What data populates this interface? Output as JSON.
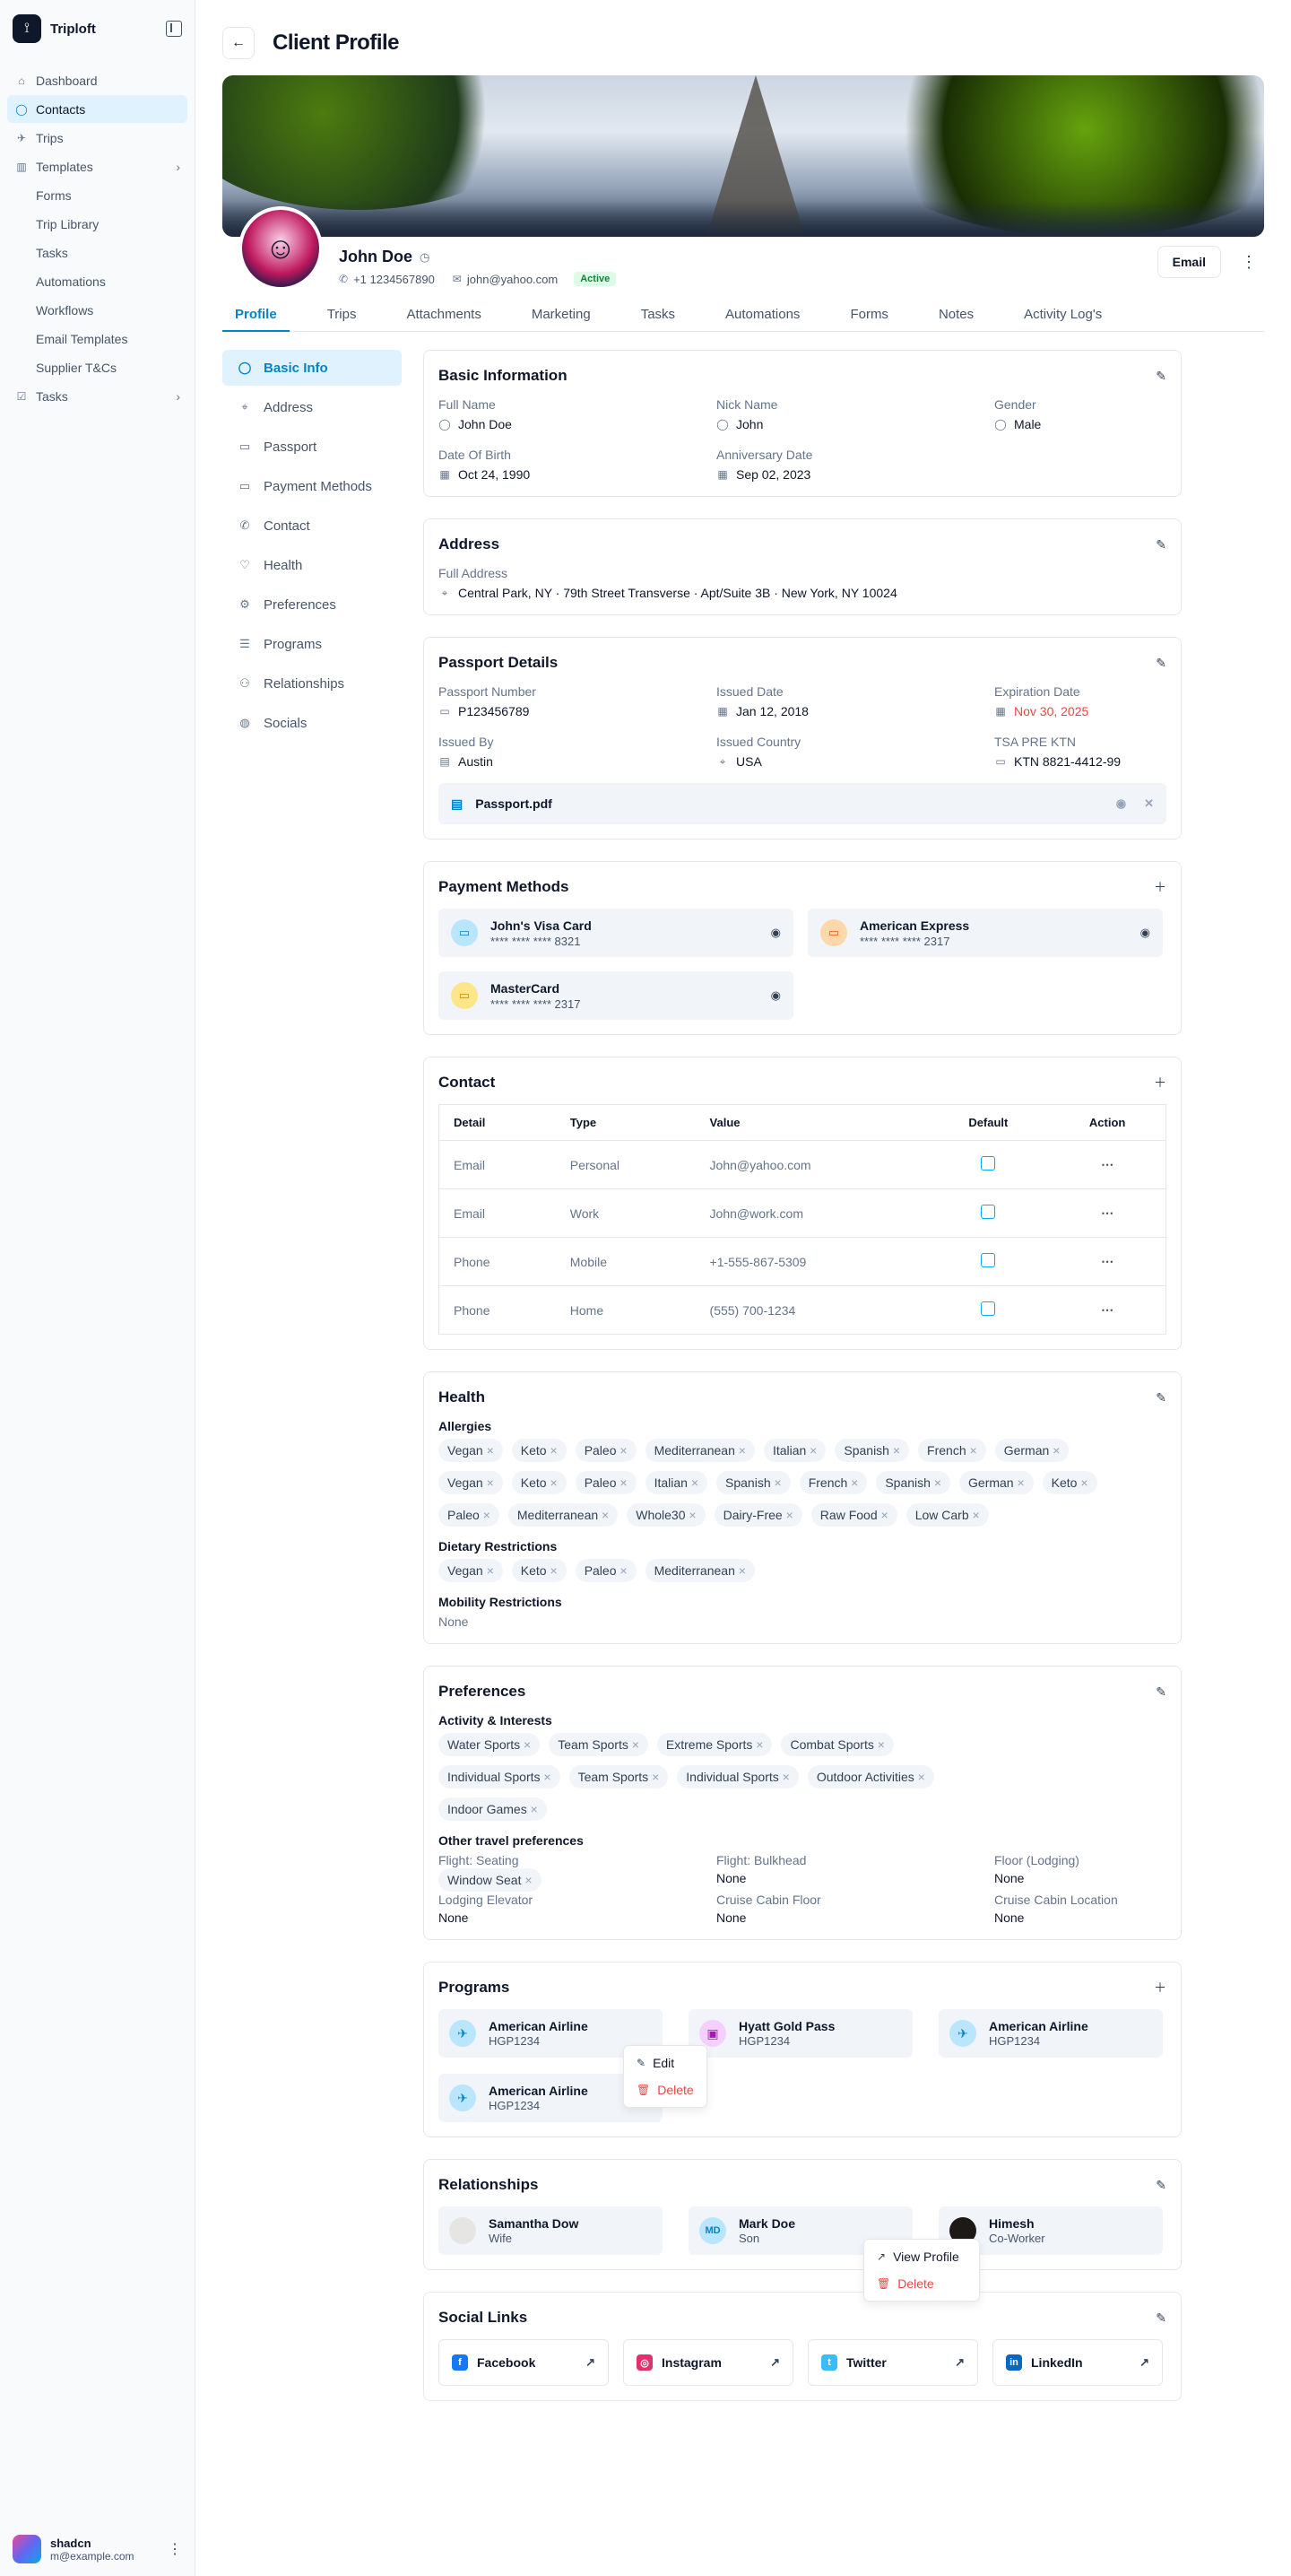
{
  "app": {
    "brand": "Triploft"
  },
  "sidebar": {
    "items": [
      {
        "label": "Dashboard",
        "icon": "home-icon",
        "glyph": "⌂"
      },
      {
        "label": "Contacts",
        "icon": "user-icon",
        "glyph": "◯",
        "active": true
      },
      {
        "label": "Trips",
        "icon": "plane-icon",
        "glyph": "✈"
      },
      {
        "label": "Templates",
        "icon": "chart-icon",
        "glyph": "▥",
        "chev": true
      }
    ],
    "sub_items": [
      "Forms",
      "Trip Library",
      "Tasks",
      "Automations",
      "Workflows",
      "Email Templates",
      "Supplier T&Cs"
    ],
    "tasks": {
      "label": "Tasks",
      "icon": "checkbox-icon",
      "glyph": "☑"
    }
  },
  "user": {
    "name": "shadcn",
    "email": "m@example.com"
  },
  "page": {
    "title": "Client Profile"
  },
  "profile": {
    "name": "John Doe",
    "phone": "+1 1234567890",
    "email": "john@yahoo.com",
    "status": "Active",
    "email_button": "Email"
  },
  "tabs": [
    "Profile",
    "Trips",
    "Attachments",
    "Marketing",
    "Tasks",
    "Automations",
    "Forms",
    "Notes",
    "Activity Log's"
  ],
  "subnav": [
    {
      "label": "Basic Info",
      "glyph": "◯",
      "active": true
    },
    {
      "label": "Address",
      "glyph": "⌖"
    },
    {
      "label": "Passport",
      "glyph": "▭"
    },
    {
      "label": "Payment Methods",
      "glyph": "▭"
    },
    {
      "label": "Contact",
      "glyph": "✆"
    },
    {
      "label": "Health",
      "glyph": "♡"
    },
    {
      "label": "Preferences",
      "glyph": "⚙"
    },
    {
      "label": "Programs",
      "glyph": "☰"
    },
    {
      "label": "Relationships",
      "glyph": "⚇"
    },
    {
      "label": "Socials",
      "glyph": "◍"
    }
  ],
  "basic": {
    "title": "Basic Information",
    "fields": [
      {
        "label": "Full Name",
        "value": "John Doe",
        "glyph": "◯"
      },
      {
        "label": "Nick Name",
        "value": "John",
        "glyph": "◯"
      },
      {
        "label": "Gender",
        "value": "Male",
        "glyph": "◯"
      },
      {
        "label": "Date Of Birth",
        "value": "Oct 24, 1990",
        "glyph": "▦"
      },
      {
        "label": "Anniversary Date",
        "value": "Sep 02, 2023",
        "glyph": "▦"
      }
    ]
  },
  "address": {
    "title": "Address",
    "label": "Full Address",
    "value": "Central Park, NY · 79th Street Transverse · Apt/Suite 3B · New York, NY 10024"
  },
  "passport": {
    "title": "Passport Details",
    "fields": [
      {
        "label": "Passport Number",
        "value": "P123456789",
        "glyph": "▭"
      },
      {
        "label": "Issued Date",
        "value": "Jan 12, 2018",
        "glyph": "▦"
      },
      {
        "label": "Expiration Date",
        "value": "Nov 30, 2025",
        "glyph": "▦",
        "red": true
      },
      {
        "label": "Issued By",
        "value": "Austin",
        "glyph": "▤"
      },
      {
        "label": "Issued Country",
        "value": "USA",
        "glyph": "⌖"
      },
      {
        "label": "TSA PRE KTN",
        "value": "KTN 8821-4412-99",
        "glyph": "▭"
      }
    ],
    "file": "Passport.pdf"
  },
  "payment": {
    "title": "Payment Methods",
    "cards": [
      {
        "name": "John's Visa Card",
        "number": "**** **** **** 8321",
        "bg": "#bae6fd",
        "fg": "#0284c7"
      },
      {
        "name": "American Express",
        "number": "**** **** **** 2317",
        "bg": "#fed7aa",
        "fg": "#ea580c"
      },
      {
        "name": "MasterCard",
        "number": "**** **** **** 2317",
        "bg": "#fde68a",
        "fg": "#ca8a04"
      }
    ]
  },
  "contact": {
    "title": "Contact",
    "headers": [
      "Detail",
      "Type",
      "Value",
      "Default",
      "Action"
    ],
    "rows": [
      [
        "Email",
        "Personal",
        "John@yahoo.com"
      ],
      [
        "Email",
        "Work",
        "John@work.com"
      ],
      [
        "Phone",
        "Mobile",
        "+1-555-867-5309"
      ],
      [
        "Phone",
        "Home",
        "(555) 700-1234"
      ]
    ]
  },
  "health": {
    "title": "Health",
    "allergies_label": "Allergies",
    "allergies": [
      "Vegan",
      "Keto",
      "Paleo",
      "Mediterranean",
      "Italian",
      "Spanish",
      "French",
      "German",
      "Vegan",
      "Keto",
      "Paleo",
      "Italian",
      "Spanish",
      "French",
      "Spanish",
      "German",
      "Keto",
      "Paleo",
      "Mediterranean",
      "Whole30",
      "Dairy-Free",
      "Raw Food",
      "Low Carb"
    ],
    "dietary_label": "Dietary Restrictions",
    "dietary": [
      "Vegan",
      "Keto",
      "Paleo",
      "Mediterranean"
    ],
    "mobility_label": "Mobility Restrictions",
    "mobility": "None"
  },
  "preferences": {
    "title": "Preferences",
    "activity_label": "Activity & Interests",
    "activities": [
      "Water Sports",
      "Team Sports",
      "Extreme Sports",
      "Combat Sports",
      "Individual Sports",
      "Team Sports",
      "Individual Sports",
      "Outdoor Activities",
      "Indoor Games"
    ],
    "other_label": "Other travel preferences",
    "other": [
      {
        "label": "Flight: Seating",
        "chip": "Window Seat"
      },
      {
        "label": "Flight: Bulkhead",
        "value": "None"
      },
      {
        "label": "Floor (Lodging)",
        "value": "None"
      },
      {
        "label": "Lodging Elevator",
        "value": "None"
      },
      {
        "label": "Cruise Cabin Floor",
        "value": "None"
      },
      {
        "label": "Cruise Cabin Location",
        "value": "None"
      }
    ]
  },
  "programs": {
    "title": "Programs",
    "items": [
      {
        "name": "American Airline",
        "code": "HGP1234",
        "glyph": "✈"
      },
      {
        "name": "Hyatt Gold Pass",
        "code": "HGP1234",
        "glyph": "▣",
        "pink": true
      },
      {
        "name": "American Airline",
        "code": "HGP1234",
        "glyph": "✈"
      },
      {
        "name": "American Airline",
        "code": "HGP1234",
        "glyph": "✈"
      }
    ],
    "menu": {
      "edit": "Edit",
      "delete": "Delete"
    }
  },
  "relationships": {
    "title": "Relationships",
    "items": [
      {
        "name": "Samantha Dow",
        "relation": "Wife",
        "initials": "",
        "bg": "#e7e5e4"
      },
      {
        "name": "Mark Doe",
        "relation": "Son",
        "initials": "MD",
        "bg": "#bae6fd"
      },
      {
        "name": "Himesh",
        "relation": "Co-Worker",
        "initials": "",
        "bg": "#1c1917"
      }
    ],
    "menu": {
      "view": "View Profile",
      "delete": "Delete"
    }
  },
  "social": {
    "title": "Social Links",
    "items": [
      {
        "name": "Facebook",
        "color": "#1877f2",
        "glyph": "f"
      },
      {
        "name": "Instagram",
        "color": "#e1306c",
        "glyph": "◎"
      },
      {
        "name": "Twitter",
        "color": "#38bdf8",
        "glyph": "t"
      },
      {
        "name": "LinkedIn",
        "color": "#0a66c2",
        "glyph": "in"
      }
    ]
  }
}
